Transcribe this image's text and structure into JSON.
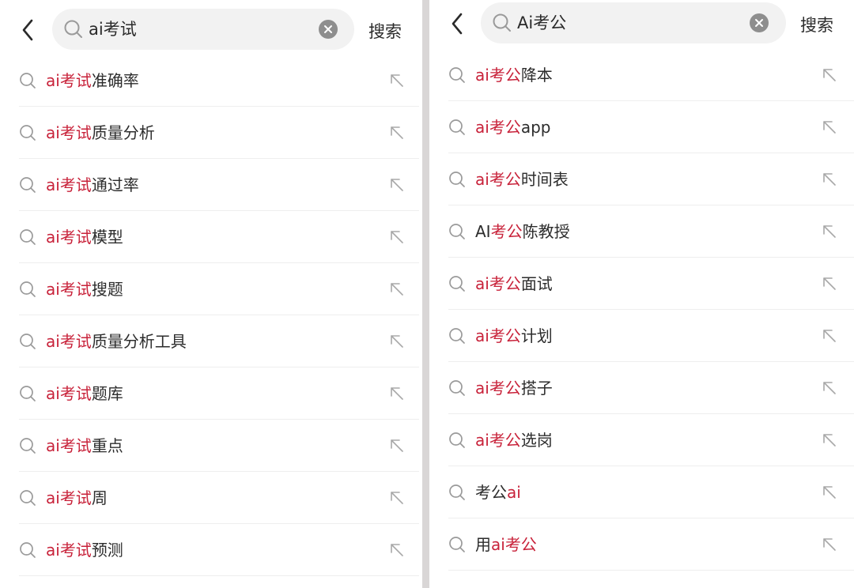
{
  "panels": [
    {
      "query": "ai考试",
      "search_label": "搜索",
      "suggestions": [
        {
          "parts": [
            {
              "text": "ai考试",
              "hl": true
            },
            {
              "text": "准确率",
              "hl": false
            }
          ]
        },
        {
          "parts": [
            {
              "text": "ai考试",
              "hl": true
            },
            {
              "text": "质量分析",
              "hl": false
            }
          ]
        },
        {
          "parts": [
            {
              "text": "ai考试",
              "hl": true
            },
            {
              "text": "通过率",
              "hl": false
            }
          ]
        },
        {
          "parts": [
            {
              "text": "ai考试",
              "hl": true
            },
            {
              "text": "模型",
              "hl": false
            }
          ]
        },
        {
          "parts": [
            {
              "text": "ai考试",
              "hl": true
            },
            {
              "text": "搜题",
              "hl": false
            }
          ]
        },
        {
          "parts": [
            {
              "text": "ai考试",
              "hl": true
            },
            {
              "text": "质量分析工具",
              "hl": false
            }
          ]
        },
        {
          "parts": [
            {
              "text": "ai考试",
              "hl": true
            },
            {
              "text": "题库",
              "hl": false
            }
          ]
        },
        {
          "parts": [
            {
              "text": "ai考试",
              "hl": true
            },
            {
              "text": "重点",
              "hl": false
            }
          ]
        },
        {
          "parts": [
            {
              "text": "ai考试",
              "hl": true
            },
            {
              "text": "周",
              "hl": false
            }
          ]
        },
        {
          "parts": [
            {
              "text": "ai考试",
              "hl": true
            },
            {
              "text": "预测",
              "hl": false
            }
          ]
        }
      ]
    },
    {
      "query": "Ai考公",
      "search_label": "搜索",
      "suggestions": [
        {
          "parts": [
            {
              "text": "ai考公",
              "hl": true
            },
            {
              "text": "降本",
              "hl": false
            }
          ]
        },
        {
          "parts": [
            {
              "text": "ai考公",
              "hl": true
            },
            {
              "text": "app",
              "hl": false
            }
          ]
        },
        {
          "parts": [
            {
              "text": "ai考公",
              "hl": true
            },
            {
              "text": "时间表",
              "hl": false
            }
          ]
        },
        {
          "parts": [
            {
              "text": "AI",
              "hl": false
            },
            {
              "text": "考公",
              "hl": true
            },
            {
              "text": "陈教授",
              "hl": false
            }
          ]
        },
        {
          "parts": [
            {
              "text": "ai考公",
              "hl": true
            },
            {
              "text": "面试",
              "hl": false
            }
          ]
        },
        {
          "parts": [
            {
              "text": "ai考公",
              "hl": true
            },
            {
              "text": "计划",
              "hl": false
            }
          ]
        },
        {
          "parts": [
            {
              "text": "ai考公",
              "hl": true
            },
            {
              "text": "搭子",
              "hl": false
            }
          ]
        },
        {
          "parts": [
            {
              "text": "ai考公",
              "hl": true
            },
            {
              "text": "选岗",
              "hl": false
            }
          ]
        },
        {
          "parts": [
            {
              "text": "考公",
              "hl": false
            },
            {
              "text": "ai",
              "hl": true
            }
          ]
        },
        {
          "parts": [
            {
              "text": "用",
              "hl": false
            },
            {
              "text": "ai考公",
              "hl": true
            }
          ]
        }
      ]
    }
  ],
  "colors": {
    "highlight": "#c8223a",
    "text": "#2c2c2c",
    "divider": "#eeeeee",
    "search_bg": "#f2f2f2"
  },
  "icons": {
    "back": "chevron-left-icon",
    "search": "search-icon",
    "clear": "clear-icon",
    "fill": "arrow-up-left-icon"
  }
}
